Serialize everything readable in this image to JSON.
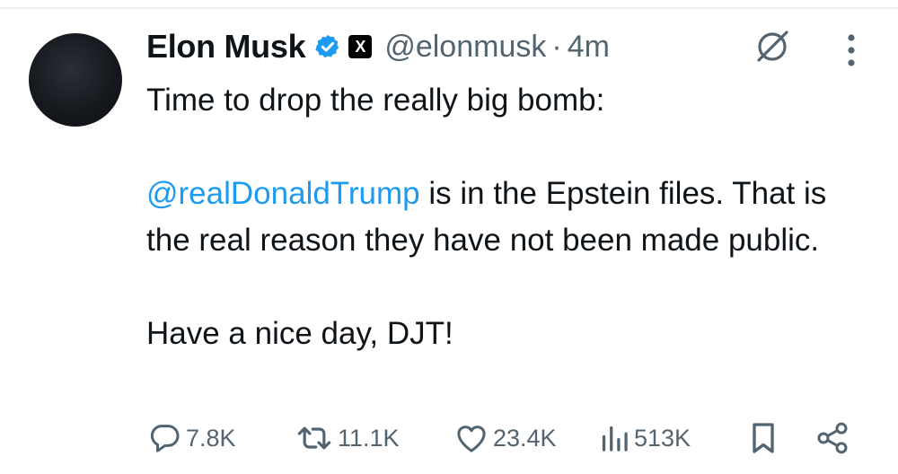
{
  "tweet": {
    "author_name": "Elon Musk",
    "handle": "@elonmusk",
    "separator": "·",
    "time": "4m",
    "badge_letter": "X",
    "body": {
      "line1": "Time to drop the really big bomb:",
      "mention": "@realDonaldTrump",
      "line2_rest": " is in the Epstein files. That is the real reason they have not been made public.",
      "line3": "Have a nice day, DJT!"
    },
    "stats": {
      "replies": "7.8K",
      "reposts": "11.1K",
      "likes": "23.4K",
      "views": "513K"
    }
  },
  "icons": {
    "verified": "verified-badge-icon",
    "grok": "grok-icon",
    "more": "more-vertical-icon",
    "reply": "reply-icon",
    "repost": "repost-icon",
    "like": "heart-icon",
    "views": "views-icon",
    "bookmark": "bookmark-icon",
    "share": "share-icon"
  },
  "colors": {
    "accent": "#1d9bf0",
    "text": "#0f1419",
    "muted": "#536471"
  }
}
